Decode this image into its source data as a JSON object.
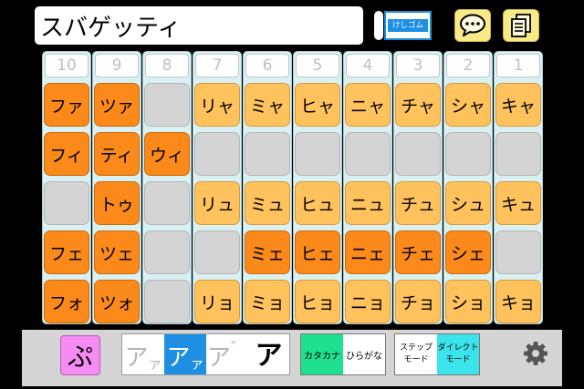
{
  "header": {
    "text": "スバゲッティ",
    "eraser_label": "けしゴム"
  },
  "columns": [
    {
      "num": "10",
      "keys": [
        {
          "label": "ファ",
          "style": "dark"
        },
        {
          "label": "フィ",
          "style": "dark"
        },
        {
          "label": "",
          "style": "empty"
        },
        {
          "label": "フェ",
          "style": "dark"
        },
        {
          "label": "フォ",
          "style": "dark"
        }
      ]
    },
    {
      "num": "9",
      "keys": [
        {
          "label": "ツァ",
          "style": "dark"
        },
        {
          "label": "ティ",
          "style": "dark"
        },
        {
          "label": "トゥ",
          "style": "dark"
        },
        {
          "label": "ツェ",
          "style": "dark"
        },
        {
          "label": "ツォ",
          "style": "dark"
        }
      ]
    },
    {
      "num": "8",
      "keys": [
        {
          "label": "",
          "style": "empty"
        },
        {
          "label": "ウィ",
          "style": "dark"
        },
        {
          "label": "",
          "style": "empty"
        },
        {
          "label": "",
          "style": "empty"
        },
        {
          "label": "",
          "style": "empty"
        }
      ]
    },
    {
      "num": "7",
      "keys": [
        {
          "label": "リャ",
          "style": "light"
        },
        {
          "label": "",
          "style": "empty"
        },
        {
          "label": "リュ",
          "style": "light"
        },
        {
          "label": "",
          "style": "empty"
        },
        {
          "label": "リョ",
          "style": "light"
        }
      ]
    },
    {
      "num": "6",
      "keys": [
        {
          "label": "ミャ",
          "style": "light"
        },
        {
          "label": "",
          "style": "empty"
        },
        {
          "label": "ミュ",
          "style": "light"
        },
        {
          "label": "ミェ",
          "style": "dark"
        },
        {
          "label": "ミョ",
          "style": "light"
        }
      ]
    },
    {
      "num": "5",
      "keys": [
        {
          "label": "ヒャ",
          "style": "light"
        },
        {
          "label": "",
          "style": "empty"
        },
        {
          "label": "ヒュ",
          "style": "light"
        },
        {
          "label": "ヒェ",
          "style": "dark"
        },
        {
          "label": "ヒョ",
          "style": "light"
        }
      ]
    },
    {
      "num": "4",
      "keys": [
        {
          "label": "ニャ",
          "style": "light"
        },
        {
          "label": "",
          "style": "empty"
        },
        {
          "label": "ニュ",
          "style": "light"
        },
        {
          "label": "ニェ",
          "style": "dark"
        },
        {
          "label": "ニョ",
          "style": "light"
        }
      ]
    },
    {
      "num": "3",
      "keys": [
        {
          "label": "チャ",
          "style": "light"
        },
        {
          "label": "",
          "style": "empty"
        },
        {
          "label": "チュ",
          "style": "light"
        },
        {
          "label": "チェ",
          "style": "dark"
        },
        {
          "label": "チョ",
          "style": "light"
        }
      ]
    },
    {
      "num": "2",
      "keys": [
        {
          "label": "シャ",
          "style": "light"
        },
        {
          "label": "",
          "style": "empty"
        },
        {
          "label": "シュ",
          "style": "light"
        },
        {
          "label": "シェ",
          "style": "dark"
        },
        {
          "label": "ショ",
          "style": "light"
        }
      ]
    },
    {
      "num": "1",
      "keys": [
        {
          "label": "キャ",
          "style": "light"
        },
        {
          "label": "",
          "style": "empty"
        },
        {
          "label": "キュ",
          "style": "light"
        },
        {
          "label": "",
          "style": "empty"
        },
        {
          "label": "キョ",
          "style": "light"
        }
      ]
    }
  ],
  "footer": {
    "small_kana_label": "ぷ",
    "size_options": [
      {
        "label": "ア",
        "small": "ァ",
        "active": false
      },
      {
        "label": "ア",
        "small": "ァ",
        "active": true
      },
      {
        "label": "ア",
        "small": "゛",
        "active": false
      },
      {
        "label": "ア",
        "small": "",
        "active": false
      }
    ],
    "kana_mode": {
      "katakana": "カタカナ",
      "hiragana": "ひらがな"
    },
    "input_mode": {
      "step_line1": "ステップ",
      "step_line2": "モード",
      "direct_line1": "ダイレクト",
      "direct_line2": "モード"
    }
  },
  "colors": {
    "key_dark": "#fb8a1a",
    "key_light": "#ffc25d",
    "key_empty": "#d4d4d4",
    "active_blue": "#1e8fe3",
    "katakana_green": "#1fe08f",
    "direct_cyan": "#3be3ea",
    "small_kana_pink": "#f58cf3",
    "icon_yellow": "#f8ea86"
  }
}
